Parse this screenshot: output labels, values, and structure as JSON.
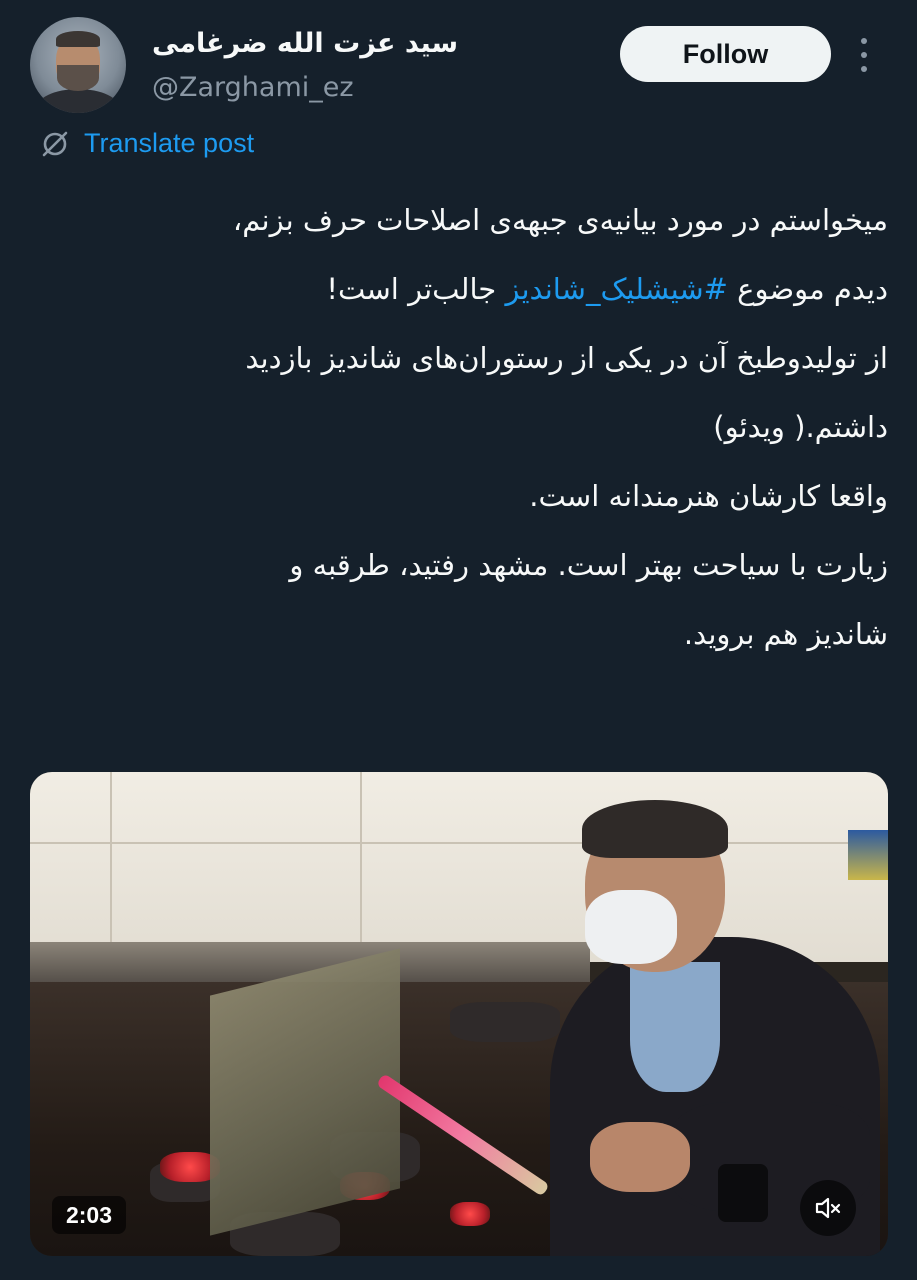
{
  "author": {
    "display_name": "سید عزت الله ضرغامی",
    "handle": "@Zarghami_ez",
    "avatar_icon": "profile-photo"
  },
  "actions": {
    "follow_label": "Follow",
    "more_icon": "more-vertical-icon"
  },
  "translate": {
    "label": "Translate post",
    "icon": "translate-slash-icon"
  },
  "tweet": {
    "line1": "میخواستم در مورد بیانیه‌ی جبهه‌ی اصلاحات حرف بزنم،",
    "line2_before": "دیدم موضوع ",
    "hashtag": "#شیشلیک_شاندیز",
    "line2_after": " جالب‌تر است!",
    "line3": "از تولیدوطبخ آن در یکی از رستوران‌های شاندیز بازدید",
    "line4": "داشتم.( ویدئو)",
    "line5": "واقعا کارشان هنرمندانه است.",
    "line6": "زیارت با سیاحت بهتر است. مشهد رفتید، طرقبه و",
    "line7": "شاندیز هم بروید."
  },
  "media": {
    "duration": "2:03",
    "mute_icon": "volume-muted-icon"
  },
  "colors": {
    "background": "#15202b",
    "accent": "#1d9bf0",
    "secondary_text": "#8b98a5",
    "follow_button": "#eff3f4"
  }
}
